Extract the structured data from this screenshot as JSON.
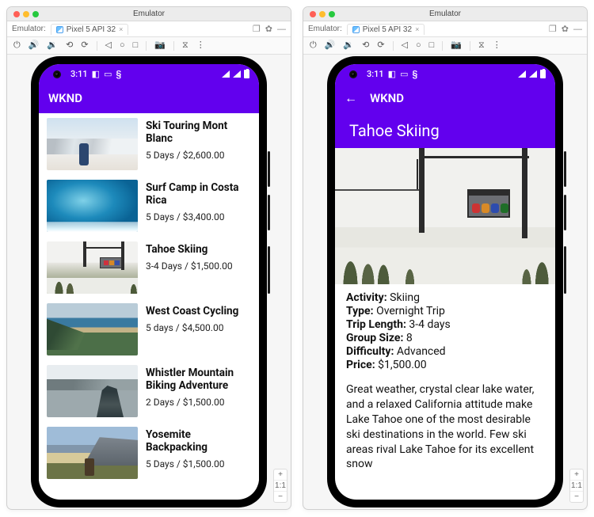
{
  "window": {
    "title": "Emulator",
    "tab_section_label": "Emulator:",
    "tab_label": "Pixel 5 API 32",
    "zoom": {
      "plus": "+",
      "ratio": "1:1",
      "minus": "−"
    }
  },
  "status": {
    "time": "3:11",
    "icons": [
      "notification-dim",
      "notification-square",
      "debug"
    ]
  },
  "list_screen": {
    "app_title": "WKND",
    "items": [
      {
        "title": "Ski Touring Mont Blanc",
        "subtitle": "5 Days / $2,600.00"
      },
      {
        "title": "Surf Camp in Costa Rica",
        "subtitle": "5 Days / $3,400.00"
      },
      {
        "title": "Tahoe Skiing",
        "subtitle": "3-4 Days / $1,500.00"
      },
      {
        "title": "West Coast Cycling",
        "subtitle": "5 days / $4,500.00"
      },
      {
        "title": "Whistler Mountain Biking Adventure",
        "subtitle": "2 Days / $1,500.00"
      },
      {
        "title": "Yosemite Backpacking",
        "subtitle": "5 Days / $1,500.00"
      }
    ]
  },
  "detail_screen": {
    "app_title": "WKND",
    "hero_title": "Tahoe Skiing",
    "spec_labels": {
      "activity": "Activity:",
      "type": "Type:",
      "trip_length": "Trip Length:",
      "group_size": "Group Size:",
      "difficulty": "Difficulty:",
      "price": "Price:"
    },
    "specs": {
      "activity": "Skiing",
      "type": "Overnight Trip",
      "trip_length": "3-4 days",
      "group_size": "8",
      "difficulty": "Advanced",
      "price": "$1,500.00"
    },
    "description": "Great weather, crystal clear lake water, and a relaxed California attitude make Lake Tahoe one of the most desirable ski destinations in the world. Few ski areas rival Lake Tahoe for its excellent snow"
  }
}
